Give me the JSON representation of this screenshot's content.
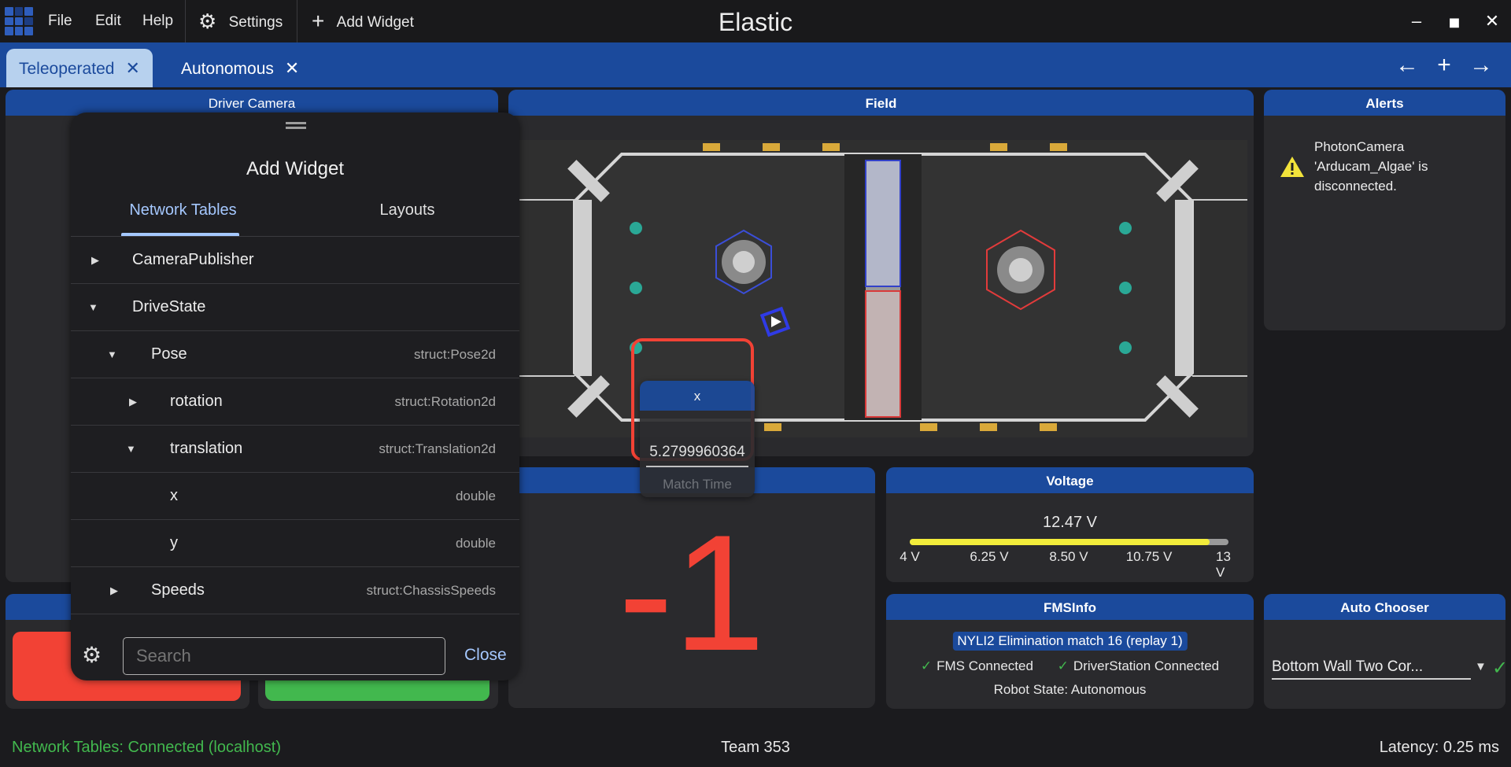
{
  "app": {
    "title": "Elastic",
    "menu": [
      "File",
      "Edit",
      "Help"
    ],
    "settings_label": "Settings",
    "add_widget_label": "Add Widget",
    "window_controls": [
      "minimize",
      "maximize",
      "close"
    ]
  },
  "tabs": [
    {
      "label": "Teleoperated",
      "active": true
    },
    {
      "label": "Autonomous",
      "active": false
    }
  ],
  "tab_nav": {
    "prev": "←",
    "add": "+",
    "next": "→"
  },
  "widgets": {
    "driver_camera": {
      "title": "Driver Camera"
    },
    "field": {
      "title": "Field"
    },
    "alerts": {
      "title": "Alerts",
      "items": [
        {
          "level": "warning",
          "text": "PhotonCamera 'Arducam_Algae' is disconnected."
        }
      ]
    },
    "voltage": {
      "title": "Voltage",
      "value_text": "12.47 V",
      "value": 12.47,
      "min": 4,
      "max": 13,
      "ticks": [
        "4 V",
        "6.25 V",
        "8.50 V",
        "10.75 V",
        "13 V"
      ],
      "bar_color": "#f2ec3b"
    },
    "match_time": {
      "value": "-1",
      "color": "#f24235"
    },
    "fms_info": {
      "title": "FMSInfo",
      "event": "NYLI2 Elimination match 16 (replay 1)",
      "fms": "FMS Connected",
      "driver_station": "DriverStation Connected",
      "robot_state": "Robot State: Autonomous"
    },
    "auto_chooser": {
      "title": "Auto Chooser",
      "selected": "Bottom Wall Two Cor..."
    },
    "buttons": {
      "left_color": "#f24235",
      "right_color": "#42b84e"
    }
  },
  "add_widget_dialog": {
    "title": "Add Widget",
    "tabs": [
      "Network Tables",
      "Layouts"
    ],
    "active_tab": "Network Tables",
    "tree": [
      {
        "name": "CameraPublisher",
        "type": "",
        "expanded": false,
        "depth": 0
      },
      {
        "name": "DriveState",
        "type": "",
        "expanded": true,
        "depth": 0
      },
      {
        "name": "Pose",
        "type": "struct:Pose2d",
        "expanded": true,
        "depth": 1
      },
      {
        "name": "rotation",
        "type": "struct:Rotation2d",
        "expanded": false,
        "depth": 2
      },
      {
        "name": "translation",
        "type": "struct:Translation2d",
        "expanded": true,
        "depth": 2
      },
      {
        "name": "x",
        "type": "double",
        "leaf": true,
        "depth": 3
      },
      {
        "name": "y",
        "type": "double",
        "leaf": true,
        "depth": 3
      },
      {
        "name": "Speeds",
        "type": "struct:ChassisSpeeds",
        "expanded": false,
        "depth": 1
      }
    ],
    "search_placeholder": "Search",
    "close_label": "Close"
  },
  "drag_preview": {
    "title": "x",
    "value": "5.2799960364",
    "underlying_label": "Match Time"
  },
  "status": {
    "connection": "Network Tables: Connected (localhost)",
    "team": "Team 353",
    "latency": "Latency:  0.25 ms",
    "connection_color": "#42b84e"
  }
}
